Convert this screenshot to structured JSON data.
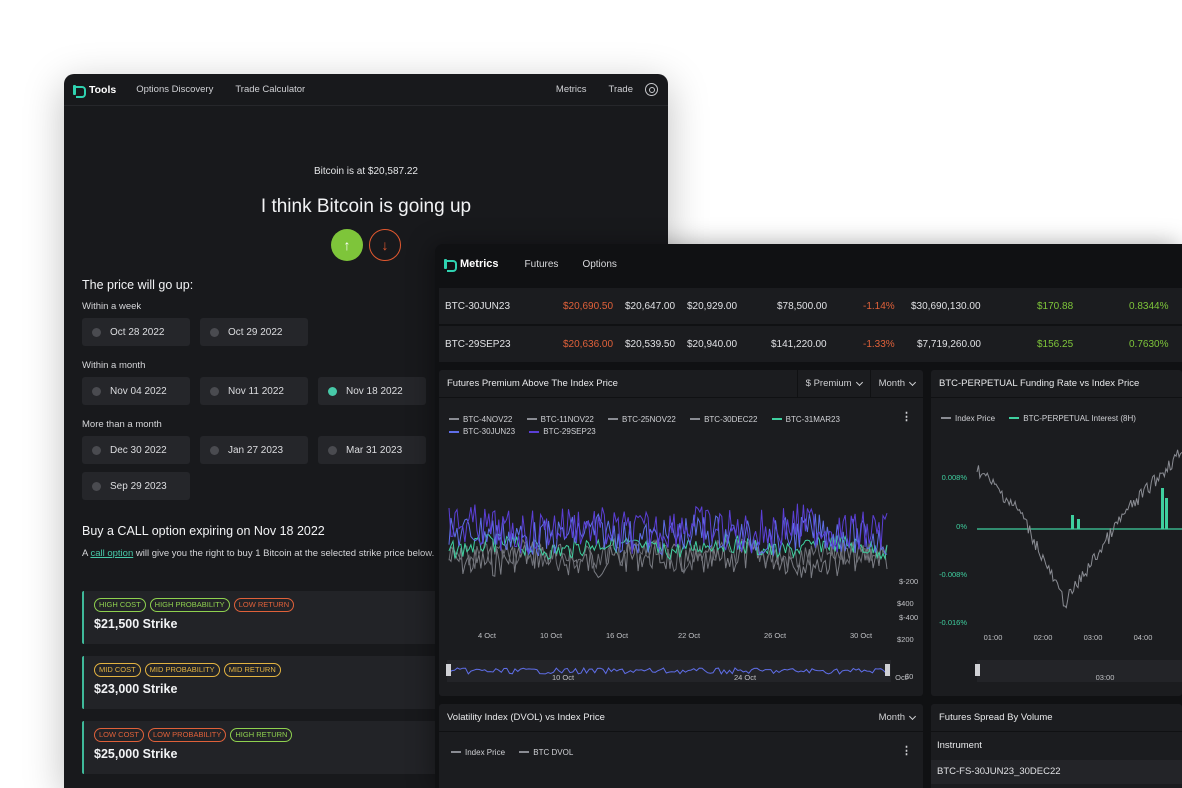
{
  "tools": {
    "brand": "Tools",
    "nav": [
      "Options Discovery",
      "Trade Calculator"
    ],
    "nav_right": [
      "Metrics",
      "Trade"
    ],
    "btc_price": "Bitcoin is at $20,587.22",
    "headline": "I think Bitcoin is going up",
    "up_icon": "↑",
    "down_icon": "↓",
    "price_will": "The price will go up:",
    "groups": [
      {
        "label": "Within a week",
        "dates": [
          {
            "text": "Oct 28 2022",
            "selected": false
          },
          {
            "text": "Oct 29 2022",
            "selected": false
          }
        ]
      },
      {
        "label": "Within a month",
        "dates": [
          {
            "text": "Nov 04 2022",
            "selected": false
          },
          {
            "text": "Nov 11 2022",
            "selected": false
          },
          {
            "text": "Nov 18 2022",
            "selected": true
          }
        ]
      },
      {
        "label": "More than a month",
        "dates": [
          {
            "text": "Dec 30 2022",
            "selected": false
          },
          {
            "text": "Jan 27 2023",
            "selected": false
          },
          {
            "text": "Mar 31 2023",
            "selected": false
          },
          {
            "text": "Sep 29 2023",
            "selected": false
          }
        ]
      }
    ],
    "buy_title": "Buy a CALL option expiring on Nov 18 2022",
    "buy_desc_pre": "A ",
    "buy_desc_link": "call option",
    "buy_desc_post": " will give you the right to buy 1 Bitcoin at the selected strike price below.",
    "strikes": [
      {
        "tags": [
          {
            "t": "HIGH COST",
            "c": "g"
          },
          {
            "t": "HIGH PROBABILITY",
            "c": "g"
          },
          {
            "t": "LOW RETURN",
            "c": "r"
          }
        ],
        "label": "$21,500 Strike"
      },
      {
        "tags": [
          {
            "t": "MID COST",
            "c": "y"
          },
          {
            "t": "MID PROBABILITY",
            "c": "y"
          },
          {
            "t": "MID RETURN",
            "c": "y"
          }
        ],
        "label": "$23,000 Strike"
      },
      {
        "tags": [
          {
            "t": "LOW COST",
            "c": "r"
          },
          {
            "t": "LOW PROBABILITY",
            "c": "r"
          },
          {
            "t": "HIGH RETURN",
            "c": "g"
          }
        ],
        "label": "$25,000 Strike"
      }
    ]
  },
  "metrics": {
    "brand": "Metrics",
    "nav": [
      "Futures",
      "Options"
    ],
    "rows": [
      {
        "inst": "BTC-30JUN23",
        "mark": "$20,690.50",
        "bid": "$20,647.00",
        "ask": "$20,929.00",
        "vol": "$78,500.00",
        "chg": "-1.14%",
        "oi": "$30,690,130.00",
        "prem": "$170.88",
        "pct": "0.8344%"
      },
      {
        "inst": "BTC-29SEP23",
        "mark": "$20,636.00",
        "bid": "$20,539.50",
        "ask": "$20,940.00",
        "vol": "$141,220.00",
        "chg": "-1.33%",
        "oi": "$7,719,260.00",
        "prem": "$156.25",
        "pct": "0.7630%"
      }
    ],
    "premium_panel": {
      "title": "Futures Premium Above The Index Price",
      "dd1": "$ Premium",
      "dd2": "Month",
      "legend": [
        {
          "name": "BTC-4NOV22",
          "color": "#8a8c93"
        },
        {
          "name": "BTC-11NOV22",
          "color": "#8a8c93"
        },
        {
          "name": "BTC-25NOV22",
          "color": "#8a8c93"
        },
        {
          "name": "BTC-30DEC22",
          "color": "#8a8c93"
        },
        {
          "name": "BTC-31MAR23",
          "color": "#3fcf9f"
        },
        {
          "name": "BTC-30JUN23",
          "color": "#5f6ee8"
        },
        {
          "name": "BTC-29SEP23",
          "color": "#5b3fd6"
        }
      ],
      "y_ticks": [
        "$400",
        "$200",
        "$0",
        "$-200",
        "$-400"
      ],
      "x_ticks": [
        "4 Oct",
        "10 Oct",
        "16 Oct",
        "22 Oct",
        "26 Oct",
        "30 Oct"
      ],
      "nav_ticks": [
        "10 Oct",
        "24 Oct",
        "Oct"
      ]
    },
    "funding_panel": {
      "title": "BTC-PERPETUAL Funding Rate vs Index Price",
      "legend": [
        {
          "name": "Index Price",
          "color": "#8a8c93"
        },
        {
          "name": "BTC-PERPETUAL Interest (8H)",
          "color": "#3fcf9f"
        }
      ],
      "y_ticks": [
        "0.008%",
        "0%",
        "-0.008%",
        "-0.016%"
      ],
      "x_ticks": [
        "01:00",
        "02:00",
        "03:00",
        "04:00"
      ],
      "nav_ticks": [
        "03:00"
      ]
    },
    "dvol_panel": {
      "title": "Volatility Index (DVOL) vs Index Price",
      "dd": "Month",
      "legend": [
        {
          "name": "Index Price",
          "color": "#8a8c93"
        },
        {
          "name": "BTC DVOL",
          "color": "#8a8c93"
        }
      ]
    },
    "spread_panel": {
      "title": "Futures Spread By Volume",
      "col_header": "Instrument",
      "first_row": "BTC-FS-30JUN23_30DEC22"
    }
  }
}
